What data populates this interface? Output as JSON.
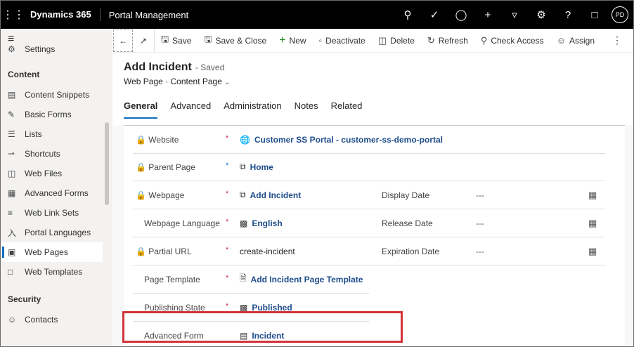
{
  "topbar": {
    "brand": "Dynamics 365",
    "app": "Portal Management",
    "icons": [
      "search-icon",
      "task-icon",
      "lightbulb-icon",
      "add-icon",
      "filter-icon",
      "settings-icon",
      "help-icon",
      "chat-icon"
    ],
    "avatar": "PD"
  },
  "sidebar": {
    "settings": "Settings",
    "content_heading": "Content",
    "items": [
      {
        "label": "Content Snippets"
      },
      {
        "label": "Basic Forms"
      },
      {
        "label": "Lists"
      },
      {
        "label": "Shortcuts"
      },
      {
        "label": "Web Files"
      },
      {
        "label": "Advanced Forms"
      },
      {
        "label": "Web Link Sets"
      },
      {
        "label": "Portal Languages"
      },
      {
        "label": "Web Pages"
      },
      {
        "label": "Web Templates"
      }
    ],
    "security_heading": "Security",
    "contacts": "Contacts"
  },
  "commands": {
    "save": "Save",
    "save_close": "Save & Close",
    "new": "New",
    "deactivate": "Deactivate",
    "delete": "Delete",
    "refresh": "Refresh",
    "check_access": "Check Access",
    "assign": "Assign"
  },
  "record": {
    "title": "Add Incident",
    "status": "- Saved",
    "entity": "Web Page",
    "form_name": "Content Page"
  },
  "tabs": [
    "General",
    "Advanced",
    "Administration",
    "Notes",
    "Related"
  ],
  "fields": {
    "website": {
      "label": "Website",
      "value": "Customer SS Portal - customer-ss-demo-portal"
    },
    "parent_page": {
      "label": "Parent Page",
      "value": "Home"
    },
    "webpage": {
      "label": "Webpage",
      "value": "Add Incident"
    },
    "webpage_language": {
      "label": "Webpage Language",
      "value": "English"
    },
    "partial_url": {
      "label": "Partial URL",
      "value": "create-incident"
    },
    "page_template": {
      "label": "Page Template",
      "value": "Add Incident Page Template"
    },
    "publishing_state": {
      "label": "Publishing State",
      "value": "Published"
    },
    "advanced_form": {
      "label": "Advanced Form",
      "value": "Incident"
    },
    "display_date": {
      "label": "Display Date",
      "value": "---"
    },
    "release_date": {
      "label": "Release Date",
      "value": "---"
    },
    "expiration_date": {
      "label": "Expiration Date",
      "value": "---"
    }
  }
}
